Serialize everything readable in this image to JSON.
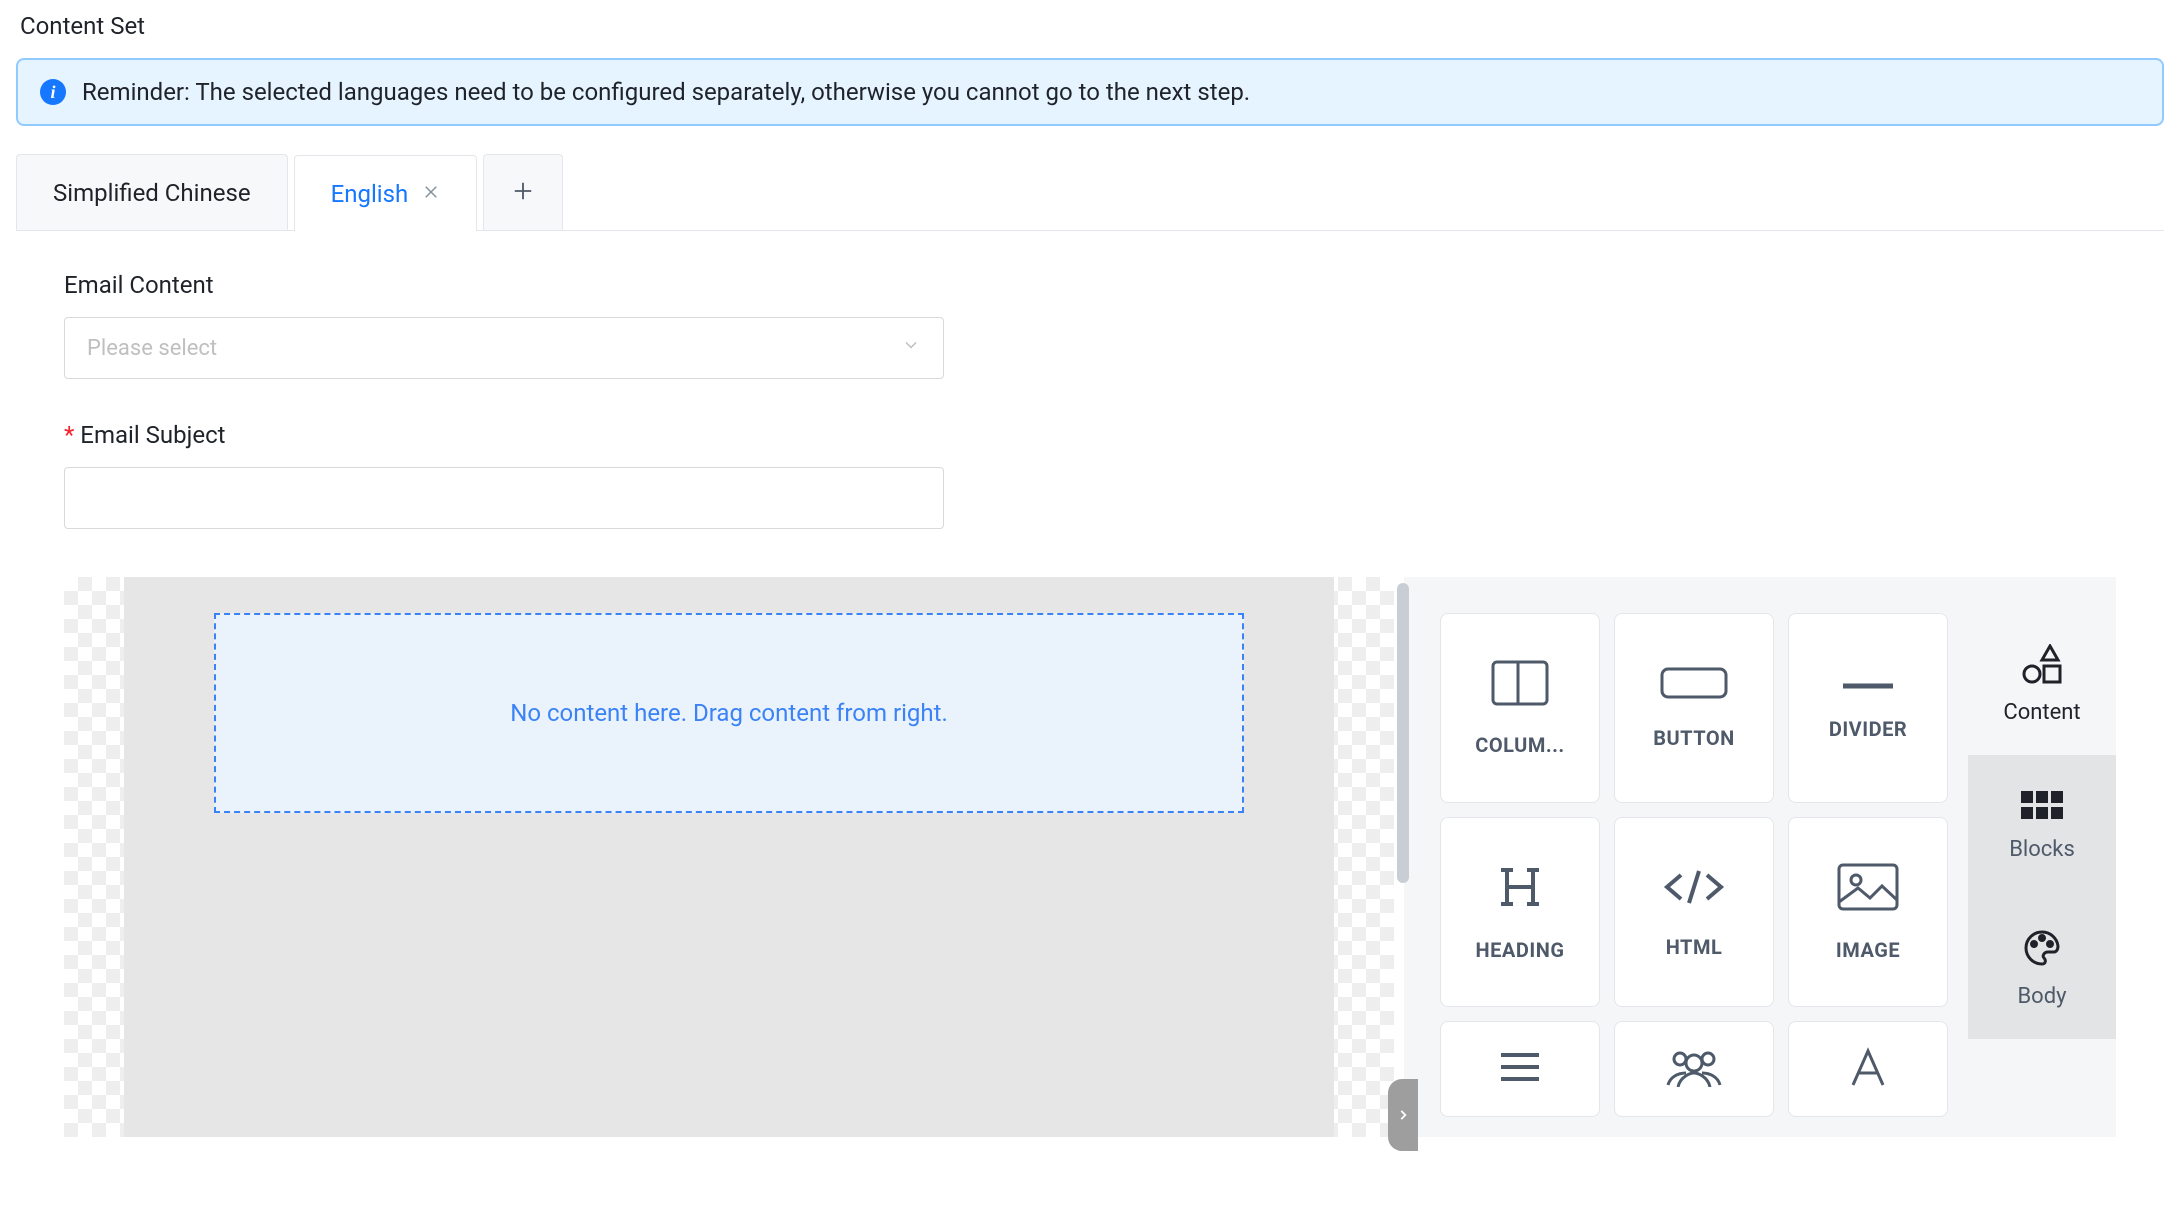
{
  "header": {
    "title": "Content Set"
  },
  "alert": {
    "message": "Reminder: The selected languages need to be configured separately, otherwise you cannot go to the next step."
  },
  "tabs": {
    "items": [
      {
        "label": "Simplified Chinese",
        "active": false,
        "closable": false
      },
      {
        "label": "English",
        "active": true,
        "closable": true
      }
    ]
  },
  "form": {
    "email_content_label": "Email Content",
    "email_content_placeholder": "Please select",
    "email_subject_label": "Email Subject",
    "email_subject_value": ""
  },
  "editor": {
    "dropzone_text": "No content here. Drag content from right."
  },
  "tools": {
    "items": [
      {
        "key": "columns",
        "label": "COLUM..."
      },
      {
        "key": "button",
        "label": "BUTTON"
      },
      {
        "key": "divider",
        "label": "DIVIDER"
      },
      {
        "key": "heading",
        "label": "HEADING"
      },
      {
        "key": "html",
        "label": "HTML"
      },
      {
        "key": "image",
        "label": "IMAGE"
      }
    ]
  },
  "side_tabs": {
    "items": [
      {
        "key": "content",
        "label": "Content",
        "active": true
      },
      {
        "key": "blocks",
        "label": "Blocks",
        "active": false
      },
      {
        "key": "body",
        "label": "Body",
        "active": false
      }
    ]
  }
}
